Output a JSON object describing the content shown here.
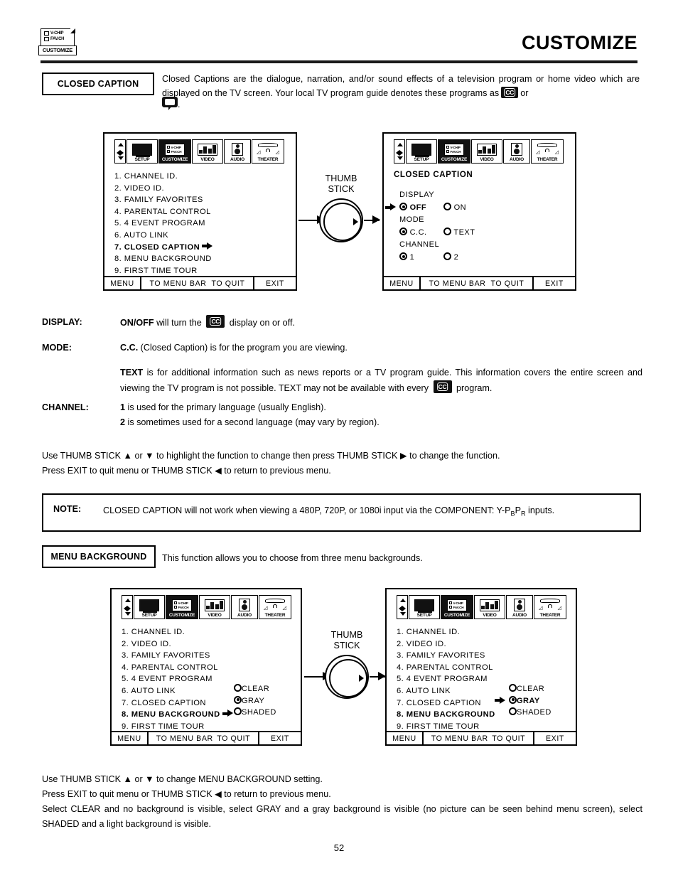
{
  "header": {
    "title": "CUSTOMIZE",
    "logo": {
      "line1": "V-CHIP",
      "line2": "FAV.CH",
      "caption": "CUSTOMIZE"
    }
  },
  "closed_caption_section": {
    "label": "CLOSED CAPTION",
    "intro_part1": "Closed Captions are the dialogue, narration, and/or sound effects of a television program or home video which are displayed on the TV screen.  Your local TV program guide denotes these programs as",
    "intro_or": "or",
    "intro_end": ".",
    "cc_icon": "cc-badge-icon",
    "bubble_icon": "speech-bubble-icon"
  },
  "menu_bar": {
    "nav_icon": "nav-arrows-icon",
    "tabs": [
      {
        "label": "SETUP",
        "icon": "tv-setup-icon",
        "selected": false
      },
      {
        "label": "CUSTOMIZE",
        "icon": "v-chip-fav-ch-icon",
        "selected": true
      },
      {
        "label": "VIDEO",
        "icon": "video-bars-icon",
        "selected": false
      },
      {
        "label": "AUDIO",
        "icon": "speaker-icon",
        "selected": false
      },
      {
        "label": "THEATER",
        "icon": "theater-icon",
        "selected": false
      }
    ]
  },
  "tv_footer": {
    "menu": "MENU",
    "to_menu_bar": "TO MENU BAR",
    "to_quit": "TO QUIT",
    "exit": "EXIT"
  },
  "screen1": {
    "items": [
      {
        "num": "1.",
        "label": "CHANNEL ID.",
        "bold": false,
        "arrow": false
      },
      {
        "num": "2.",
        "label": "VIDEO ID.",
        "bold": false,
        "arrow": false
      },
      {
        "num": "3.",
        "label": "FAMILY FAVORITES",
        "bold": false,
        "arrow": false
      },
      {
        "num": "4.",
        "label": "PARENTAL CONTROL",
        "bold": false,
        "arrow": false
      },
      {
        "num": "5.",
        "label": "4 EVENT PROGRAM",
        "bold": false,
        "arrow": false
      },
      {
        "num": "6.",
        "label": "AUTO LINK",
        "bold": false,
        "arrow": false
      },
      {
        "num": "7.",
        "label": "CLOSED CAPTION",
        "bold": true,
        "arrow": true
      },
      {
        "num": "8.",
        "label": "MENU BACKGROUND",
        "bold": false,
        "arrow": false
      },
      {
        "num": "9.",
        "label": "FIRST TIME TOUR",
        "bold": false,
        "arrow": false
      }
    ]
  },
  "screen2": {
    "title": "CLOSED CAPTION",
    "groups": [
      {
        "name": "DISPLAY",
        "cursor": true,
        "options": [
          {
            "label": "OFF",
            "selected": true,
            "bold": true
          },
          {
            "label": "ON",
            "selected": false,
            "bold": false
          }
        ]
      },
      {
        "name": "MODE",
        "cursor": false,
        "options": [
          {
            "label": "C.C.",
            "selected": true,
            "bold": false
          },
          {
            "label": "TEXT",
            "selected": false,
            "bold": false
          }
        ]
      },
      {
        "name": "CHANNEL",
        "cursor": false,
        "options": [
          {
            "label": "1",
            "selected": true,
            "bold": false
          },
          {
            "label": "2",
            "selected": false,
            "bold": false
          }
        ]
      }
    ]
  },
  "thumb_stick": {
    "line1": "THUMB",
    "line2": "STICK"
  },
  "definitions": [
    {
      "term": "DISPLAY:",
      "lines": [
        {
          "bold": "ON/OFF",
          "text_before_icon": " will turn the ",
          "icon": "cc-badge-icon",
          "text_after_icon": " display on or off."
        }
      ]
    },
    {
      "term": "MODE:",
      "lines": [
        {
          "bold": "C.C.",
          "text_before_icon": " (Closed Caption) is for the program you are viewing.",
          "icon": null,
          "text_after_icon": ""
        }
      ]
    },
    {
      "term": "",
      "lines": [
        {
          "bold": "TEXT",
          "text_before_icon": " is for additional information such as news reports or a TV program guide.  This information covers the entire screen and viewing the TV program is not possible.  TEXT may not be available with every ",
          "icon": "cc-badge-icon",
          "text_after_icon": " program."
        }
      ]
    },
    {
      "term": "CHANNEL:",
      "lines": [
        {
          "bold": "1",
          "text_before_icon": " is used for the primary language (usually English).",
          "icon": null,
          "text_after_icon": ""
        },
        {
          "bold": "2",
          "text_before_icon": " is sometimes used for a second language (may vary by region).",
          "icon": null,
          "text_after_icon": ""
        }
      ]
    }
  ],
  "instructions_cc": {
    "line1": "Use THUMB STICK ▲ or ▼ to highlight the function to change then press THUMB STICK ▶ to change the function.",
    "line2": "Press EXIT to quit menu or THUMB STICK ◀ to return to previous menu."
  },
  "note": {
    "label": "NOTE:",
    "text_a": "CLOSED CAPTION will not work when viewing a 480P, 720P, or 1080i input via the COMPONENT: Y-P",
    "sub_b": "B",
    "text_b": "P",
    "sub_r": "R",
    "text_c": " inputs."
  },
  "menu_background_section": {
    "label": "MENU BACKGROUND",
    "description": "This function allows you to choose from three menu backgrounds."
  },
  "screen3": {
    "items": [
      {
        "num": "1.",
        "label": "CHANNEL ID.",
        "bold": false,
        "arrow": false
      },
      {
        "num": "2.",
        "label": "VIDEO ID.",
        "bold": false,
        "arrow": false
      },
      {
        "num": "3.",
        "label": "FAMILY FAVORITES",
        "bold": false,
        "arrow": false
      },
      {
        "num": "4.",
        "label": "PARENTAL CONTROL",
        "bold": false,
        "arrow": false
      },
      {
        "num": "5.",
        "label": "4 EVENT PROGRAM",
        "bold": false,
        "arrow": false
      },
      {
        "num": "6.",
        "label": "AUTO LINK",
        "bold": false,
        "arrow": false
      },
      {
        "num": "7.",
        "label": "CLOSED CAPTION",
        "bold": false,
        "arrow": false
      },
      {
        "num": "8.",
        "label": "MENU BACKGROUND",
        "bold": true,
        "arrow": true
      },
      {
        "num": "9.",
        "label": "FIRST TIME TOUR",
        "bold": false,
        "arrow": false
      }
    ],
    "options": [
      {
        "label": "CLEAR",
        "selected": false,
        "bold": false,
        "cursor": false
      },
      {
        "label": "GRAY",
        "selected": true,
        "bold": false,
        "cursor": false
      },
      {
        "label": "SHADED",
        "selected": false,
        "bold": false,
        "cursor": false
      }
    ]
  },
  "screen4": {
    "items": [
      {
        "num": "1.",
        "label": "CHANNEL ID.",
        "bold": false,
        "arrow": false
      },
      {
        "num": "2.",
        "label": "VIDEO ID.",
        "bold": false,
        "arrow": false
      },
      {
        "num": "3.",
        "label": "FAMILY FAVORITES",
        "bold": false,
        "arrow": false
      },
      {
        "num": "4.",
        "label": "PARENTAL CONTROL",
        "bold": false,
        "arrow": false
      },
      {
        "num": "5.",
        "label": "4 EVENT PROGRAM",
        "bold": false,
        "arrow": false
      },
      {
        "num": "6.",
        "label": "AUTO LINK",
        "bold": false,
        "arrow": false
      },
      {
        "num": "7.",
        "label": "CLOSED CAPTION",
        "bold": false,
        "arrow": false
      },
      {
        "num": "8.",
        "label": "MENU BACKGROUND",
        "bold": true,
        "arrow": false
      },
      {
        "num": "9.",
        "label": "FIRST TIME TOUR",
        "bold": false,
        "arrow": false
      }
    ],
    "options": [
      {
        "label": "CLEAR",
        "selected": false,
        "bold": false,
        "cursor": false
      },
      {
        "label": "GRAY",
        "selected": true,
        "bold": true,
        "cursor": true
      },
      {
        "label": "SHADED",
        "selected": false,
        "bold": false,
        "cursor": false
      }
    ]
  },
  "instructions_bg": {
    "line1": "Use THUMB STICK ▲ or ▼ to change MENU BACKGROUND setting.",
    "line2": "Press EXIT to quit menu or THUMB STICK ◀ to return to previous menu.",
    "line3": "Select CLEAR and no background is visible, select GRAY and a gray background is visible (no picture can be seen behind menu screen), select SHADED and a light background is visible."
  },
  "page_number": "52"
}
